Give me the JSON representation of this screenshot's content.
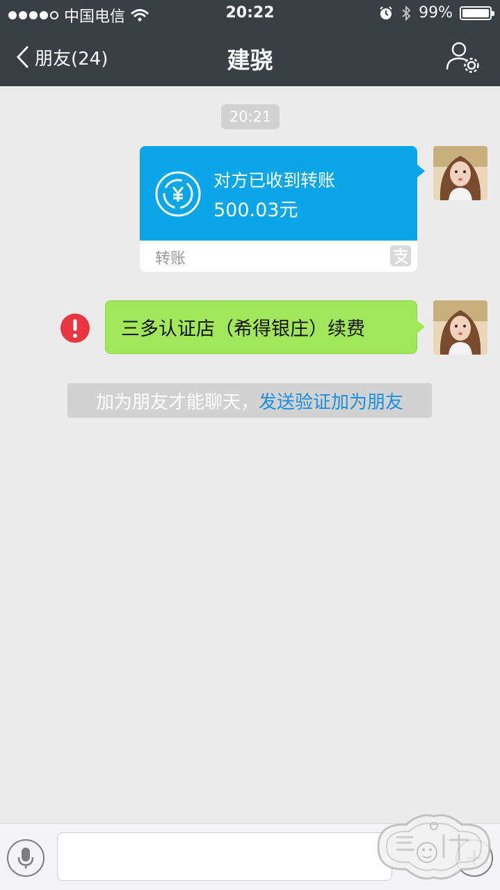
{
  "status_bar": {
    "carrier": "中国电信",
    "time": "20:22",
    "battery": "99%",
    "battery_level": 0.99
  },
  "nav": {
    "back_label": "朋友(24)",
    "title": "建骁"
  },
  "chat": {
    "timestamp": "20:21",
    "transfer": {
      "status": "对方已收到转账",
      "amount": "500.03元",
      "footer": "转账"
    },
    "failed_message": {
      "text": "三多认证店（希得银庄）续费"
    },
    "system_notice": {
      "text": "加为朋友才能聊天，",
      "link": "发送验证加为朋友"
    }
  },
  "input_bar": {
    "placeholder": ""
  },
  "colors": {
    "nav_bg": "#3a3e45",
    "chat_bg": "#ebebeb",
    "transfer_blue": "#0aa6e8",
    "bubble_green": "#a0e75a",
    "error_red": "#e8353f",
    "link_blue": "#1a8fe0"
  }
}
